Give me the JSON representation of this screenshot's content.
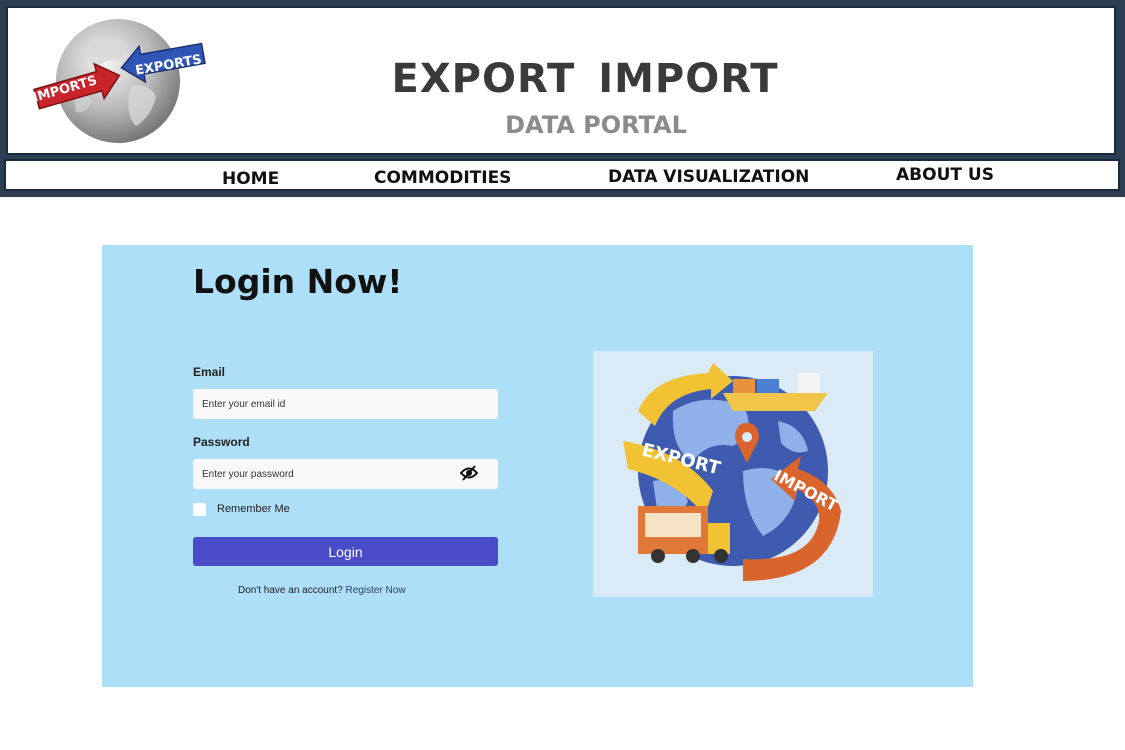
{
  "header": {
    "title": "EXPORT IMPORT",
    "subtitle": "DATA PORTAL",
    "logo": {
      "icon": "globe-arrows-logo",
      "left_arrow_text": "IMPORTS",
      "right_arrow_text": "EXPORTS"
    }
  },
  "nav": {
    "items": [
      {
        "label": "HOME"
      },
      {
        "label": "COMMODITIES"
      },
      {
        "label": "DATA VISUALIZATION"
      },
      {
        "label": "ABOUT US"
      }
    ]
  },
  "login": {
    "title": "Login Now!",
    "email_label": "Email",
    "email_placeholder": "Enter your email id",
    "email_value": "",
    "password_label": "Password",
    "password_placeholder": "Enter your password",
    "password_value": "",
    "password_icon": "eye-slash-icon",
    "remember_label": "Remember Me",
    "remember_checked": false,
    "button_label": "Login",
    "register_prompt": "Don't have an account?",
    "register_link": "Register Now"
  },
  "illustration": {
    "icon": "globe-trade-illustration",
    "export_text": "EXPORT",
    "import_text": "IMPORT"
  },
  "colors": {
    "header_frame": "#2b3e52",
    "card_background": "#addff8",
    "button": "#4a4bc7",
    "title_text": "#3a3a3a",
    "subtitle_text": "#8b8b8b"
  }
}
